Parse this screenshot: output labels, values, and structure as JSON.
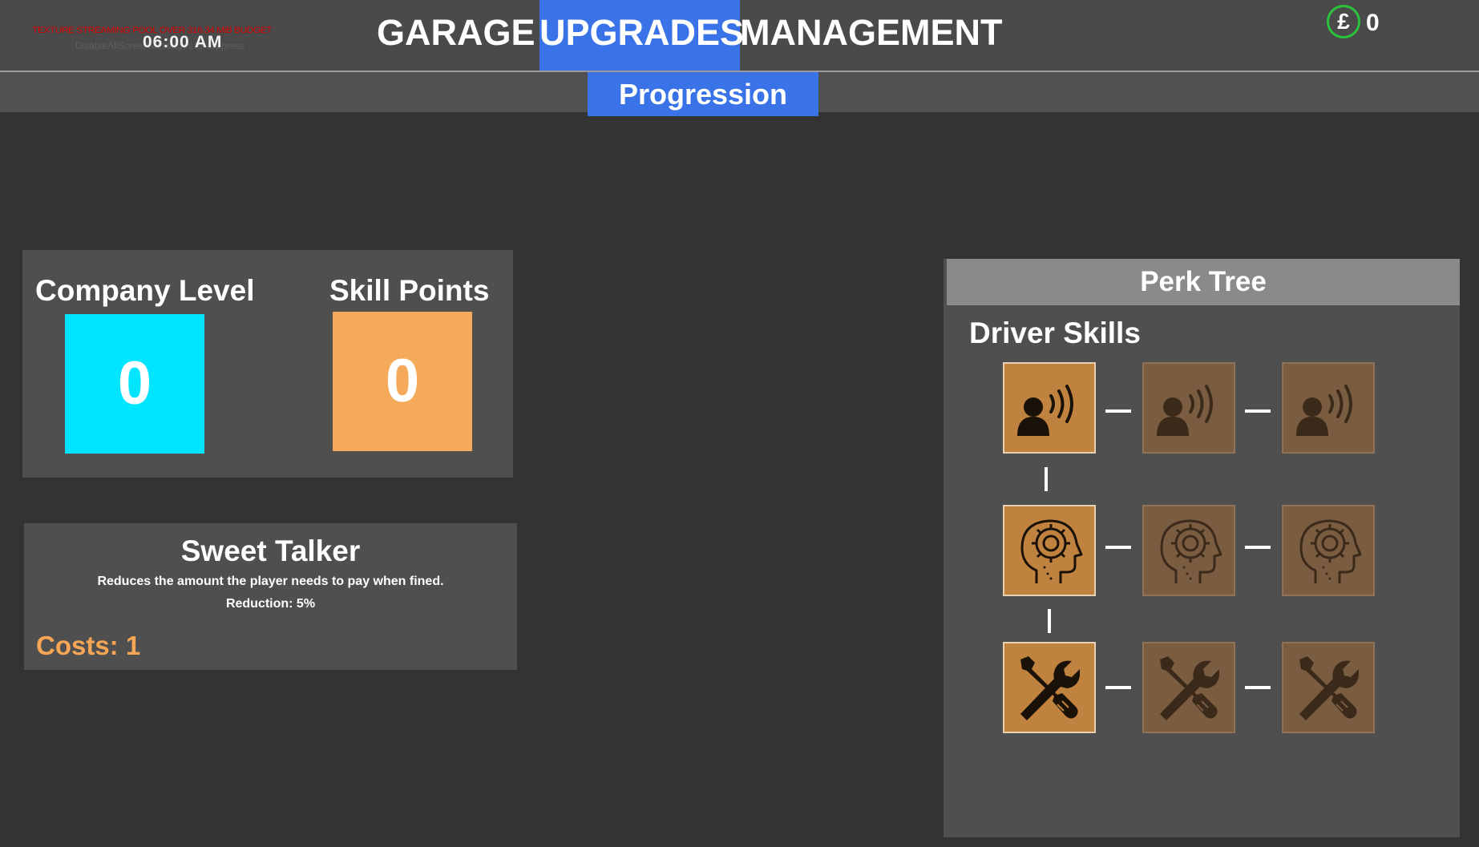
{
  "hud": {
    "debug_warning": "TEXTURE STREAMING POOL OVER 316.34 MiB BUDGET",
    "debug_sub": "DisableAllScreenMessages to suppress",
    "time": "06:00 AM"
  },
  "nav": {
    "tabs": [
      {
        "label": "GARAGE",
        "active": false
      },
      {
        "label": "UPGRADES",
        "active": true
      },
      {
        "label": "MANAGEMENT",
        "active": false
      }
    ],
    "subtab": "Progression"
  },
  "wallet": {
    "currency_symbol": "£",
    "amount": "0",
    "ring_color": "#29c23b"
  },
  "stats": {
    "company_level_label": "Company Level",
    "company_level_value": "0",
    "skill_points_label": "Skill Points",
    "skill_points_value": "0",
    "level_color": "#00e5ff",
    "points_color": "#f5a95a"
  },
  "selected_perk": {
    "name": "Sweet Talker",
    "description": "Reduces the amount the player needs to pay when fined.",
    "effect": "Reduction: 5%",
    "cost": "Costs: 1"
  },
  "perk_tree": {
    "title": "Perk Tree",
    "category": "Driver Skills",
    "rows": [
      {
        "icon": "person-talking-icon",
        "tiers": [
          true,
          false,
          false
        ]
      },
      {
        "icon": "head-gear-icon",
        "tiers": [
          true,
          false,
          false
        ]
      },
      {
        "icon": "wrench-screwdriver-icon",
        "tiers": [
          true,
          false,
          false
        ]
      }
    ],
    "unlocked_color": "#c0833f",
    "locked_color": "#7a5c40"
  }
}
